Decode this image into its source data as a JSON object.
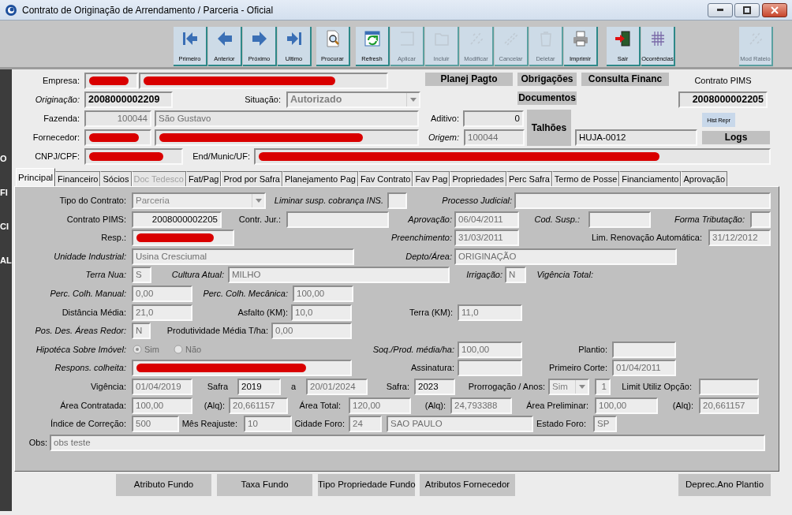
{
  "window": {
    "title": "Contrato de Originação de Arrendamento / Parceria - Oficial"
  },
  "toolbar": {
    "groups": [
      [
        {
          "label": "Primeiro",
          "enabled": true
        },
        {
          "label": "Anterior",
          "enabled": true
        },
        {
          "label": "Próximo",
          "enabled": true
        },
        {
          "label": "Ultimo",
          "enabled": true
        }
      ],
      [
        {
          "label": "Procurar",
          "enabled": true
        }
      ],
      [
        {
          "label": "Refresh",
          "enabled": true
        },
        {
          "label": "Aplicar",
          "enabled": false
        },
        {
          "label": "Incluir",
          "enabled": false
        },
        {
          "label": "Modificar",
          "enabled": false
        },
        {
          "label": "Cancelar",
          "enabled": false
        },
        {
          "label": "Deletar",
          "enabled": false
        },
        {
          "label": "Imprimir",
          "enabled": true
        }
      ],
      [
        {
          "label": "Sair",
          "enabled": true
        },
        {
          "label": "Ocorrências",
          "enabled": true
        }
      ]
    ],
    "right_button": {
      "label": "Mod Rateio",
      "enabled": false
    }
  },
  "side_label": "OFICIAL",
  "header": {
    "rows": [
      {
        "items": [
          {
            "kind": "label",
            "text": "Empresa:",
            "italic": false
          },
          {
            "kind": "field",
            "redacted": true
          },
          {
            "kind": "field",
            "redacted": true
          },
          {
            "kind": "button",
            "label": "Planej Pagto"
          },
          {
            "kind": "button",
            "label": "Obrigações"
          },
          {
            "kind": "button",
            "label": "Consulta Financ"
          },
          {
            "kind": "label",
            "text": "Contrato PIMS",
            "italic": false
          }
        ]
      },
      {
        "items": [
          {
            "kind": "label",
            "text": "Originação:",
            "italic": true
          },
          {
            "kind": "field",
            "value": "2008000002209",
            "editable": true,
            "bold": true
          },
          {
            "kind": "label",
            "text": "Situação:",
            "italic": false
          },
          {
            "kind": "select",
            "value": "Autorizado",
            "disabled": true,
            "bold": true
          },
          {
            "kind": "button",
            "label": "Documentos"
          },
          {
            "kind": "field",
            "value": "2008000002205",
            "editable": true,
            "bold": true
          }
        ]
      },
      {
        "items": [
          {
            "kind": "label",
            "text": "Fazenda:",
            "italic": false
          },
          {
            "kind": "field",
            "value": "100044",
            "editable": false
          },
          {
            "kind": "field",
            "value": "São Gustavo",
            "editable": false
          },
          {
            "kind": "label",
            "text": "Aditivo:",
            "italic": false
          },
          {
            "kind": "field",
            "value": "0",
            "editable": true
          },
          {
            "kind": "button",
            "label": "Talhões"
          },
          {
            "kind": "button",
            "label": "Hist Repr"
          }
        ]
      },
      {
        "items": [
          {
            "kind": "label",
            "text": "Fornecedor:",
            "italic": false
          },
          {
            "kind": "field",
            "redacted": true
          },
          {
            "kind": "field",
            "redacted": true
          },
          {
            "kind": "label",
            "text": "Origem:",
            "italic": true
          },
          {
            "kind": "field",
            "value": "100044",
            "editable": false
          },
          {
            "kind": "field",
            "value": "HUJA-0012",
            "editable": true
          },
          {
            "kind": "button",
            "label": "Logs"
          }
        ]
      },
      {
        "items": [
          {
            "kind": "label",
            "text": "CNPJ/CPF:",
            "italic": false
          },
          {
            "kind": "field",
            "redacted": true
          },
          {
            "kind": "label",
            "text": "End/Munic/UF:",
            "italic": false
          },
          {
            "kind": "field",
            "redacted": true
          }
        ]
      }
    ]
  },
  "tabs": [
    {
      "label": "Principal",
      "selected": true,
      "disabled": false
    },
    {
      "label": "Financeiro",
      "selected": false,
      "disabled": false
    },
    {
      "label": "Sócios",
      "selected": false,
      "disabled": false
    },
    {
      "label": "Doc Tedesco",
      "selected": false,
      "disabled": true
    },
    {
      "label": "Fat/Pag",
      "selected": false,
      "disabled": false
    },
    {
      "label": "Prod por Safra",
      "selected": false,
      "disabled": false
    },
    {
      "label": "Planejamento Pag",
      "selected": false,
      "disabled": false
    },
    {
      "label": "Fav Contrato",
      "selected": false,
      "disabled": false
    },
    {
      "label": "Fav Pag",
      "selected": false,
      "disabled": false
    },
    {
      "label": "Propriedades",
      "selected": false,
      "disabled": false
    },
    {
      "label": "Perc Safra",
      "selected": false,
      "disabled": false
    },
    {
      "label": "Termo de Posse",
      "selected": false,
      "disabled": false
    },
    {
      "label": "Financiamento",
      "selected": false,
      "disabled": false
    },
    {
      "label": "Aprovação",
      "selected": false,
      "disabled": false
    }
  ],
  "form": {
    "rows": [
      {
        "items": [
          {
            "kind": "label",
            "text": "Tipo do Contrato:",
            "italic": false
          },
          {
            "kind": "select",
            "value": "Parceria",
            "disabled": true
          },
          {
            "kind": "label",
            "text": "Liminar susp. cobrança INS.",
            "italic": true
          },
          {
            "kind": "field"
          },
          {
            "kind": "label",
            "text": "Processo Judicial:",
            "italic": true
          },
          {
            "kind": "field"
          }
        ]
      },
      {
        "items": [
          {
            "kind": "label",
            "text": "Contrato PIMS:",
            "italic": false
          },
          {
            "kind": "field",
            "value": "2008000002205",
            "editable": true
          },
          {
            "kind": "label",
            "text": "Contr. Jur.:",
            "italic": false
          },
          {
            "kind": "field"
          },
          {
            "kind": "label",
            "text": "Aprovação:",
            "italic": true
          },
          {
            "kind": "field",
            "value": "06/04/2011",
            "editable": false
          },
          {
            "kind": "label",
            "text": "Cod. Susp.:",
            "italic": true
          },
          {
            "kind": "field"
          },
          {
            "kind": "label",
            "text": "Forma Tributação:",
            "italic": true
          },
          {
            "kind": "field"
          }
        ]
      },
      {
        "items": [
          {
            "kind": "label",
            "text": "Resp.:",
            "italic": false
          },
          {
            "kind": "field",
            "redacted": true
          },
          {
            "kind": "label",
            "text": "Preenchimento:",
            "italic": true
          },
          {
            "kind": "field",
            "value": "31/03/2011",
            "editable": false
          },
          {
            "kind": "label",
            "text": "Lim. Renovação Automática:",
            "italic": false
          },
          {
            "kind": "field",
            "value": "31/12/2012",
            "editable": false
          }
        ]
      },
      {
        "items": [
          {
            "kind": "label",
            "text": "Unidade Industrial:",
            "italic": true
          },
          {
            "kind": "field",
            "value": "Usina Cresciumal",
            "editable": false
          },
          {
            "kind": "label",
            "text": "Depto/Área:",
            "italic": true
          },
          {
            "kind": "field",
            "value": "ORIGINAÇÃO",
            "editable": false
          }
        ]
      },
      {
        "items": [
          {
            "kind": "label",
            "text": "Terra Nua:",
            "italic": true
          },
          {
            "kind": "field",
            "value": "S",
            "editable": false
          },
          {
            "kind": "label",
            "text": "Cultura Atual:",
            "italic": true
          },
          {
            "kind": "field",
            "value": "MILHO",
            "editable": false
          },
          {
            "kind": "label",
            "text": "Irrigação:",
            "italic": true
          },
          {
            "kind": "field",
            "value": "N",
            "editable": false
          },
          {
            "kind": "label",
            "text": "Vigência Total:",
            "italic": true
          }
        ]
      },
      {
        "items": [
          {
            "kind": "label",
            "text": "Perc. Colh. Manual:",
            "italic": true
          },
          {
            "kind": "field",
            "value": "0,00",
            "editable": false
          },
          {
            "kind": "label",
            "text": "Perc. Colh. Mecânica:",
            "italic": true
          },
          {
            "kind": "field",
            "value": "100,00",
            "editable": false
          }
        ]
      },
      {
        "items": [
          {
            "kind": "label",
            "text": "Distância Média:",
            "italic": false
          },
          {
            "kind": "field",
            "value": "21,0",
            "editable": false
          },
          {
            "kind": "label",
            "text": "Asfalto (KM):",
            "italic": false
          },
          {
            "kind": "field",
            "value": "10,0",
            "editable": false
          },
          {
            "kind": "label",
            "text": "Terra (KM):",
            "italic": false
          },
          {
            "kind": "field",
            "value": "11,0",
            "editable": false
          }
        ]
      },
      {
        "items": [
          {
            "kind": "label",
            "text": "Pos. Des. Áreas Redor:",
            "italic": true
          },
          {
            "kind": "field",
            "value": "N",
            "editable": false
          },
          {
            "kind": "label",
            "text": "Produtividade Média T/ha:",
            "italic": false
          },
          {
            "kind": "field",
            "value": "0,00",
            "editable": false
          }
        ]
      },
      {
        "items": [
          {
            "kind": "label",
            "text": "Hipotéca Sobre Imóvel:",
            "italic": true
          },
          {
            "kind": "radio",
            "label": "Sim",
            "checked": true,
            "disabled": true
          },
          {
            "kind": "radio",
            "label": "Não",
            "checked": false,
            "disabled": true
          },
          {
            "kind": "label",
            "text": "Soq./Prod. média/ha:",
            "italic": true
          },
          {
            "kind": "field",
            "value": "100,00",
            "editable": false
          },
          {
            "kind": "label",
            "text": "Plantio:",
            "italic": false
          },
          {
            "kind": "field"
          }
        ]
      },
      {
        "items": [
          {
            "kind": "label",
            "text": "Respons. colheita:",
            "italic": true
          },
          {
            "kind": "field",
            "redacted": true
          },
          {
            "kind": "label",
            "text": "Assinatura:",
            "italic": false
          },
          {
            "kind": "field"
          },
          {
            "kind": "label",
            "text": "Primeiro Corte:",
            "italic": false
          },
          {
            "kind": "field",
            "value": "01/04/2011",
            "editable": false
          }
        ]
      },
      {
        "items": [
          {
            "kind": "label",
            "text": "Vigência:",
            "italic": false
          },
          {
            "kind": "field",
            "value": "01/04/2019",
            "editable": false
          },
          {
            "kind": "label",
            "text": "Safra",
            "italic": false
          },
          {
            "kind": "field",
            "value": "2019",
            "editable": true
          },
          {
            "kind": "label",
            "text": "a",
            "italic": false
          },
          {
            "kind": "field",
            "value": "20/01/2024",
            "editable": false
          },
          {
            "kind": "label",
            "text": "Safra:",
            "italic": false
          },
          {
            "kind": "field",
            "value": "2023",
            "editable": true
          },
          {
            "kind": "label",
            "text": "Prorrogação / Anos:",
            "italic": false
          },
          {
            "kind": "select",
            "value": "Sim",
            "disabled": true
          },
          {
            "kind": "field",
            "value": "1",
            "editable": false
          },
          {
            "kind": "label",
            "text": "Limit Utiliz Opção:",
            "italic": false
          },
          {
            "kind": "field"
          }
        ]
      },
      {
        "items": [
          {
            "kind": "label",
            "text": "Área Contratada:",
            "italic": false
          },
          {
            "kind": "field",
            "value": "100,00",
            "editable": false
          },
          {
            "kind": "label",
            "text": "(Alq):",
            "italic": false
          },
          {
            "kind": "field",
            "value": "20,661157",
            "editable": false
          },
          {
            "kind": "label",
            "text": "Área Total:",
            "italic": false
          },
          {
            "kind": "field",
            "value": "120,00",
            "editable": false
          },
          {
            "kind": "label",
            "text": "(Alq):",
            "italic": false
          },
          {
            "kind": "field",
            "value": "24,793388",
            "editable": false
          },
          {
            "kind": "label",
            "text": "Área Preliminar:",
            "italic": false
          },
          {
            "kind": "field",
            "value": "100,00",
            "editable": false
          },
          {
            "kind": "label",
            "text": "(Alq):",
            "italic": false
          },
          {
            "kind": "field",
            "value": "20,661157",
            "editable": false
          }
        ]
      },
      {
        "items": [
          {
            "kind": "label",
            "text": "Índice de Correção:",
            "italic": false
          },
          {
            "kind": "field",
            "value": "500",
            "editable": false
          },
          {
            "kind": "label",
            "text": "Mês Reajuste:",
            "italic": false
          },
          {
            "kind": "field",
            "value": "10",
            "editable": false
          },
          {
            "kind": "label",
            "text": "Cidade Foro:",
            "italic": false
          },
          {
            "kind": "field",
            "value": "24",
            "editable": false
          },
          {
            "kind": "field",
            "value": "SAO PAULO",
            "editable": false
          },
          {
            "kind": "label",
            "text": "Estado Foro:",
            "italic": false
          },
          {
            "kind": "field",
            "value": "SP",
            "editable": false
          }
        ]
      },
      {
        "items": [
          {
            "kind": "label",
            "text": "Obs:",
            "italic": false
          },
          {
            "kind": "field",
            "value": "obs teste",
            "editable": false
          }
        ]
      }
    ]
  },
  "bottom_buttons": [
    "Atributo Fundo",
    "Taxa Fundo",
    "Tipo Propriedade Fundo",
    "Atributos Fornecedor",
    "Deprec.Ano Plantio"
  ]
}
